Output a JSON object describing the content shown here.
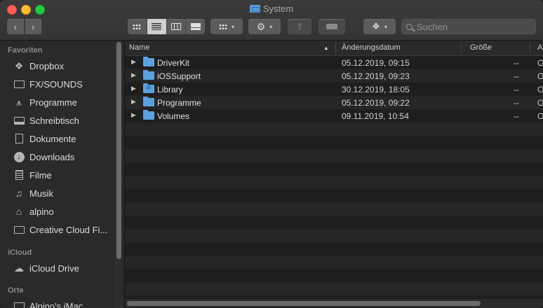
{
  "window": {
    "title": "System"
  },
  "toolbar": {
    "back_icon": "chevron-left-icon",
    "forward_icon": "chevron-right-icon",
    "view_modes": [
      "icon-view",
      "list-view",
      "column-view",
      "gallery-view"
    ],
    "active_view": "list-view"
  },
  "search": {
    "placeholder": "Suchen"
  },
  "sidebar": {
    "sections": [
      {
        "title": "Favoriten",
        "items": [
          {
            "label": "Dropbox",
            "icon": "dropbox-icon"
          },
          {
            "label": "FX/SOUNDS",
            "icon": "folder-icon"
          },
          {
            "label": "Programme",
            "icon": "applications-icon"
          },
          {
            "label": "Schreibtisch",
            "icon": "desktop-icon"
          },
          {
            "label": "Dokumente",
            "icon": "document-icon"
          },
          {
            "label": "Downloads",
            "icon": "download-icon"
          },
          {
            "label": "Filme",
            "icon": "film-icon"
          },
          {
            "label": "Musik",
            "icon": "music-icon"
          },
          {
            "label": "alpino",
            "icon": "home-icon"
          },
          {
            "label": "Creative Cloud Fi...",
            "icon": "folder-icon"
          }
        ]
      },
      {
        "title": "iCloud",
        "items": [
          {
            "label": "iCloud Drive",
            "icon": "cloud-icon"
          }
        ]
      },
      {
        "title": "Orte",
        "items": [
          {
            "label": "Alpino's iMac",
            "icon": "computer-icon"
          }
        ]
      }
    ]
  },
  "columns": {
    "name": "Name",
    "date": "Änderungsdatum",
    "size": "Größe",
    "kind": "A"
  },
  "files": [
    {
      "name": "DriverKit",
      "date": "05.12.2019, 09:15",
      "size": "--",
      "kind": "O"
    },
    {
      "name": "iOSSupport",
      "date": "05.12.2019, 09:23",
      "size": "--",
      "kind": "O"
    },
    {
      "name": "Library",
      "date": "30.12.2019, 18:05",
      "size": "--",
      "kind": "O"
    },
    {
      "name": "Programme",
      "date": "05.12.2019, 09:22",
      "size": "--",
      "kind": "O"
    },
    {
      "name": "Volumes",
      "date": "09.11.2019, 10:54",
      "size": "--",
      "kind": "O"
    }
  ]
}
